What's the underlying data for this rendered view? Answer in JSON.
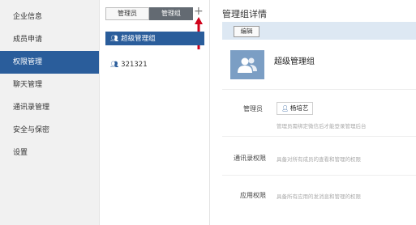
{
  "sidebar": {
    "items": [
      {
        "label": "企业信息"
      },
      {
        "label": "成员申请"
      },
      {
        "label": "权限管理"
      },
      {
        "label": "聊天管理"
      },
      {
        "label": "通讯录管理"
      },
      {
        "label": "安全与保密"
      },
      {
        "label": "设置"
      }
    ],
    "active_index": 2
  },
  "middle": {
    "tabs": [
      {
        "label": "管理员"
      },
      {
        "label": "管理组"
      }
    ],
    "active_tab": 1,
    "add_symbol": "+",
    "groups": [
      {
        "label": "超级管理组"
      },
      {
        "label": "321321"
      }
    ]
  },
  "detail": {
    "title": "管理组详情",
    "edit_label": "编辑",
    "group_name": "超级管理组",
    "admin_label": "管理员",
    "admin_name": "杨培艺",
    "admin_hint": "管理员需绑定微信后才能登录管理后台",
    "contacts_label": "通讯录权限",
    "contacts_hint": "具备对所有成员的查看和管理的权限",
    "apps_label": "应用权限",
    "apps_hint": "具备所有应用的发消息和管理的权限"
  },
  "colors": {
    "accent": "#2a5d9b",
    "toolbar_bg": "#dde8f3",
    "annotation_arrow": "#d0021b"
  }
}
